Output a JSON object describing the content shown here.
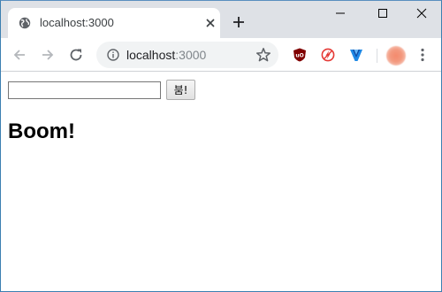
{
  "browser": {
    "tab": {
      "title": "localhost:3000"
    },
    "omnibox": {
      "host": "localhost",
      "port": ":3000"
    },
    "icons": {
      "tab": "globe-icon",
      "close": "close-icon",
      "new_tab": "plus-icon",
      "back": "back-arrow-icon",
      "forward": "forward-arrow-icon",
      "reload": "reload-icon",
      "info": "info-icon",
      "bookmark": "star-icon",
      "extensions": [
        "ublock-icon",
        "flash-blocker-icon",
        "v-extension-icon"
      ],
      "menu": "more-vert-icon"
    }
  },
  "page": {
    "input": {
      "value": ""
    },
    "button_label": "붐!",
    "heading": "Boom!"
  },
  "colors": {
    "tabstrip": "#dee1e6",
    "omnibox": "#f1f3f4",
    "window_border": "#3c7fb1",
    "ublock": "#800000",
    "flash": "#e53935",
    "v_extension": "#1e88e5"
  }
}
